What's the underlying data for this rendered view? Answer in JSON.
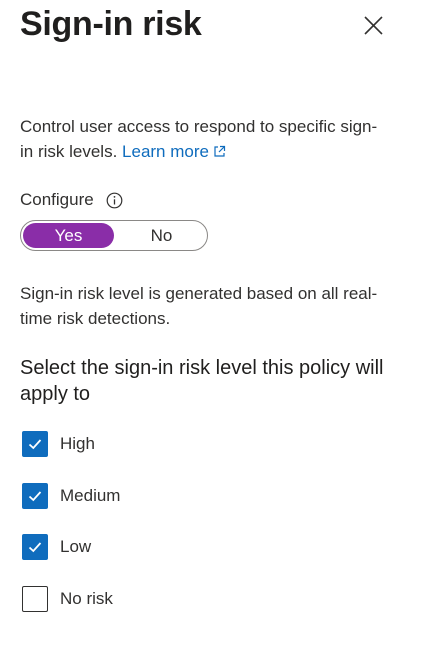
{
  "header": {
    "title": "Sign-in risk",
    "close_icon": "close-icon"
  },
  "description": {
    "text": "Control user access to respond to specific sign-in risk levels. ",
    "link_text": "Learn more",
    "link_icon": "external-link-icon"
  },
  "configure": {
    "label": "Configure",
    "info_icon": "info-icon",
    "toggle": {
      "yes_label": "Yes",
      "no_label": "No",
      "selected": "Yes"
    }
  },
  "note": "Sign-in risk level is generated based on all real-time risk detections.",
  "risk_levels": {
    "heading": "Select the sign-in risk level this policy will apply to",
    "items": [
      {
        "label": "High",
        "checked": true
      },
      {
        "label": "Medium",
        "checked": true
      },
      {
        "label": "Low",
        "checked": true
      },
      {
        "label": "No risk",
        "checked": false
      }
    ]
  },
  "colors": {
    "toggle_selected": "#8a2da8",
    "checkbox_checked": "#0f6cbd",
    "link": "#0f6cbd"
  }
}
